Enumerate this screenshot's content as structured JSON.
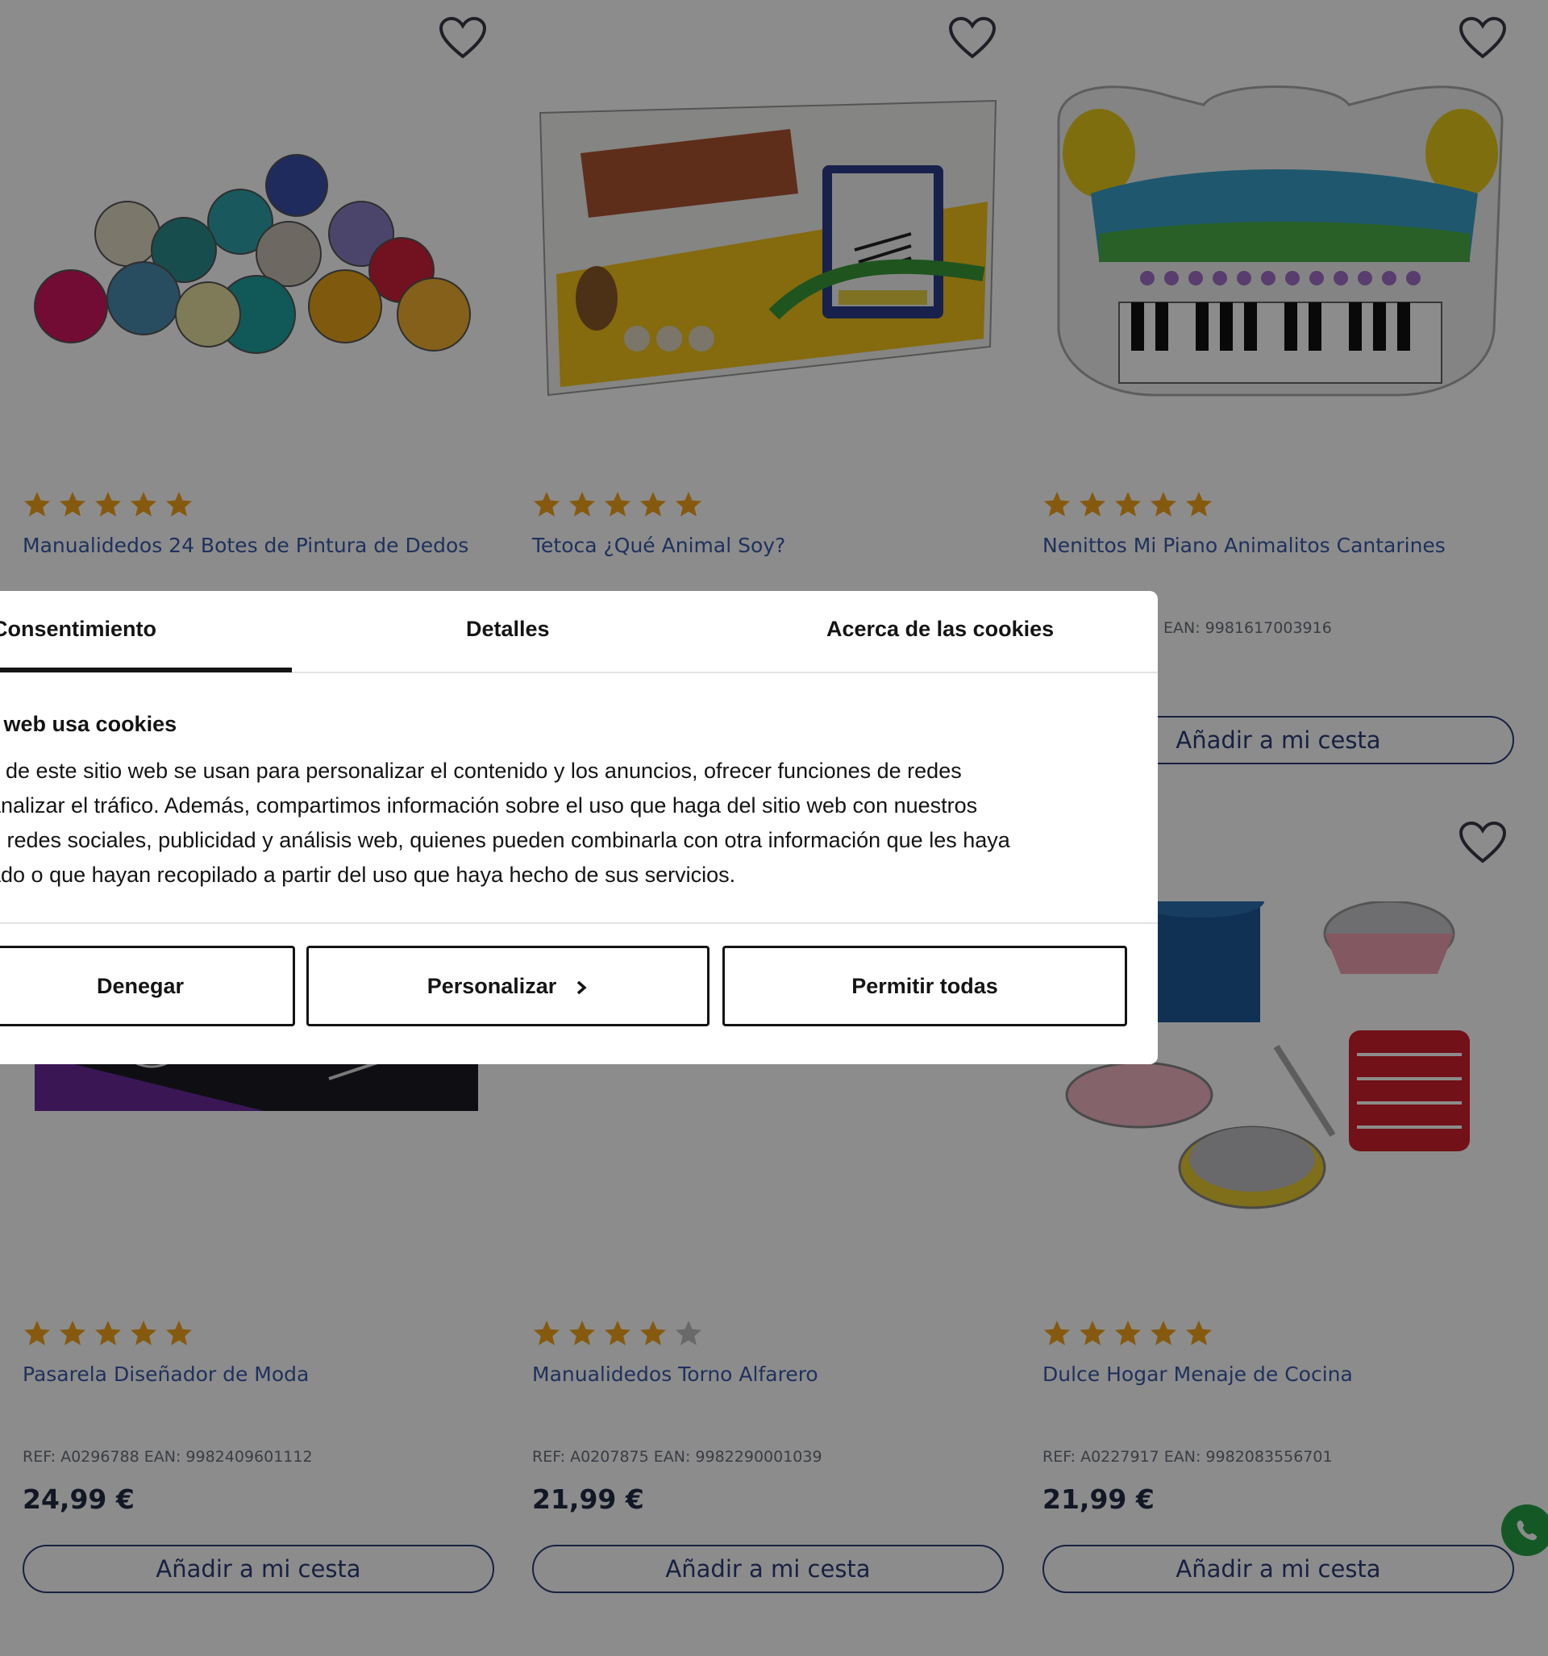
{
  "colors": {
    "overlay": "#000000",
    "product_name": "#3a5aa8",
    "accent_outline": "#2a3c78",
    "star_filled": "#f2a51c",
    "star_empty": "#bfbfbf",
    "whatsapp": "#25a244"
  },
  "products": [
    {
      "name": "Manualidedos 24 Botes de Pintura de Dedos",
      "rating": 5,
      "ref": "",
      "price": "",
      "add_label": "",
      "image": "paint-pots"
    },
    {
      "name": "Tetoca ¿Qué Animal Soy?",
      "rating": 5,
      "ref": "",
      "price": "",
      "add_label": "",
      "image": "que-animal-soy-box"
    },
    {
      "name": "Nenittos Mi Piano Animalitos Cantarines",
      "rating": 5,
      "ref": "EAN: 9981617003916",
      "price": "",
      "add_label": "Añadir a mi cesta",
      "image": "toy-piano"
    },
    {
      "name": "Pasarela Diseñador de Moda",
      "rating": 5,
      "ref": "REF: A0296788 EAN: 9982409601112",
      "price": "24,99 €",
      "add_label": "Añadir a mi cesta",
      "image": "fashion-designer-box"
    },
    {
      "name": "Manualidedos Torno Alfarero",
      "rating": 4,
      "ref": "REF: A0207875 EAN: 9982290001039",
      "price": "21,99 €",
      "add_label": "Añadir a mi cesta",
      "image": "pottery-wheel"
    },
    {
      "name": "Dulce Hogar Menaje de Cocina",
      "rating": 5,
      "ref": "REF: A0227917 EAN: 9982083556701",
      "price": "21,99 €",
      "add_label": "Añadir a mi cesta",
      "image": "kitchen-set"
    }
  ],
  "cookie_dialog": {
    "tabs": [
      "Consentimiento",
      "Detalles",
      "Acerca de las cookies"
    ],
    "active_tab": 0,
    "heading": "a web usa cookies",
    "body_lines": [
      "s de este sitio web se usan para personalizar el contenido y los anuncios, ofrecer funciones de redes",
      "analizar el tráfico. Además, compartimos información sobre el uso que haga del sitio web con nuestros",
      "e redes sociales, publicidad y análisis web, quienes pueden combinarla con otra información que les haya",
      "ado o que hayan recopilado a partir del uso que haya hecho de sus servicios."
    ],
    "buttons": {
      "deny": "Denegar",
      "customize": "Personalizar",
      "allow_all": "Permitir todas"
    }
  }
}
